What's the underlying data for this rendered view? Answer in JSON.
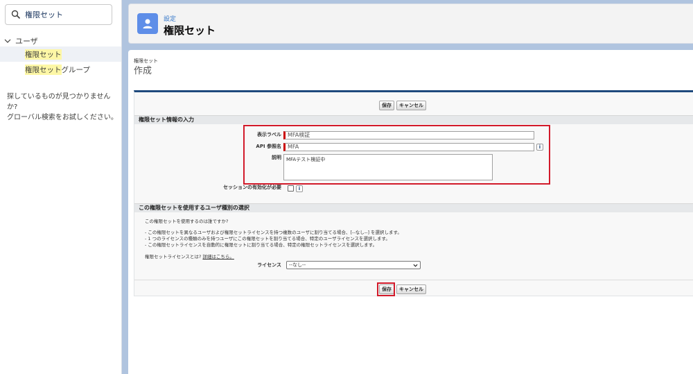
{
  "sidebar": {
    "search_value": "権限セット",
    "group_label": "ユーザ",
    "items": [
      {
        "highlight": "権限セット",
        "rest": ""
      },
      {
        "highlight": "権限セット",
        "rest": "グループ"
      }
    ],
    "help_line1": "探しているものが見つかりませんか?",
    "help_line2": "グローバル検索をお試しください。"
  },
  "header": {
    "subtitle": "設定",
    "title": "権限セット"
  },
  "page": {
    "small_title": "権限セット",
    "big_title": "作成"
  },
  "buttons": {
    "save": "保存",
    "cancel": "キャンセル"
  },
  "section1": {
    "title": "権限セット情報の入力",
    "label_field": "表示ラベル",
    "label_value": "MFA検証",
    "api_field": "API 参照名",
    "api_value": "MFA",
    "desc_field": "説明",
    "desc_value": "MFAテスト検証中",
    "session_field": "セッションの有効化が必要",
    "info_glyph": "i"
  },
  "section2": {
    "title": "この権限セットを使用するユーザ種別の選択",
    "question": "この権限セットを使用するのは誰ですか?",
    "bullet1": "- この権限セットを異なるユーザおよび権限セットライセンスを持つ複数のユーザに割り当てる場合、[--なし--] を選択します。",
    "bullet2": "- 1 つのライセンスの種類のみを持つユーザにこの権限セットを割り当てる場合、特定のユーザライセンスを選択します。",
    "bullet3": "- この権限セットライセンスを自動的に権限セットに割り当てる場合、特定の権限セットライセンスを選択します。",
    "license_question": "権限セットライセンスとは?",
    "details_link": "詳細はこちら。",
    "license_label": "ライセンス",
    "license_selected": "--なし--"
  },
  "colors": {
    "accent": "#1f4a7d",
    "highlight_outline": "#d21a2a",
    "header_icon": "#5e8ee8",
    "page_background": "#b0c4df"
  }
}
